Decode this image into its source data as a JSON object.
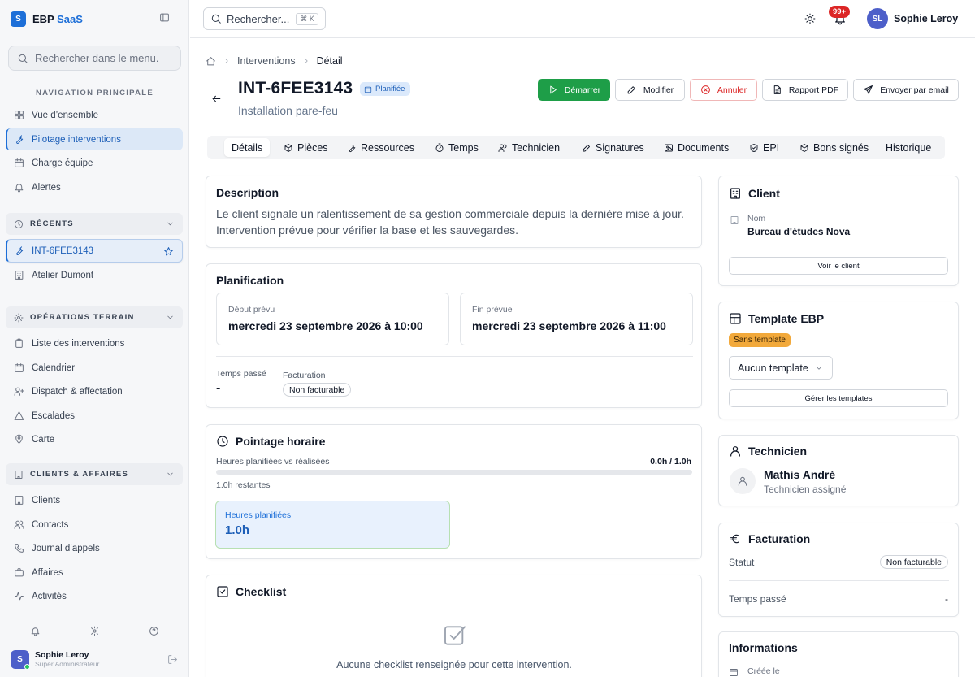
{
  "colors": {
    "accent": "#1d6fd8",
    "start": "#1e9e48",
    "danger": "#dc2626",
    "template_badge": "#f2a93b",
    "notif_badge": "#dc2626"
  },
  "sidebar": {
    "brand": {
      "logo_letter": "S",
      "name_prefix": "EBP",
      "name_accent": "SaaS"
    },
    "collapse_icon": "sidebar-toggle-icon",
    "search_placeholder": "Rechercher dans le menu.",
    "main_section_label": "NAVIGATION PRINCIPALE",
    "main_items": [
      {
        "label": "Vue d’ensemble",
        "icon": "grid-icon"
      },
      {
        "label": "Pilotage interventions",
        "icon": "wrench-icon",
        "active": true
      },
      {
        "label": "Charge équipe",
        "icon": "calendar-icon"
      },
      {
        "label": "Alertes",
        "icon": "bell-icon"
      }
    ],
    "recent_label": "RÉCENTS",
    "recent_items": [
      {
        "label": "INT-6FEE3143",
        "icon": "wrench-icon",
        "active": true
      },
      {
        "label": "Atelier Dumont",
        "icon": "building-icon"
      }
    ],
    "ops_label": "OPÉRATIONS TERRAIN",
    "ops_items": [
      {
        "label": "Liste des interventions",
        "icon": "clipboard-icon"
      },
      {
        "label": "Calendrier",
        "icon": "calendar-icon"
      },
      {
        "label": "Dispatch & affectation",
        "icon": "user-plus-icon"
      },
      {
        "label": "Escalades",
        "icon": "alert-triangle-icon"
      },
      {
        "label": "Carte",
        "icon": "map-pin-icon"
      }
    ],
    "clients_label": "CLIENTS & AFFAIRES",
    "clients_items": [
      {
        "label": "Clients",
        "icon": "building-icon"
      },
      {
        "label": "Contacts",
        "icon": "users-icon"
      },
      {
        "label": "Journal d’appels",
        "icon": "phone-icon"
      },
      {
        "label": "Affaires",
        "icon": "briefcase-icon"
      },
      {
        "label": "Activités",
        "icon": "activity-icon"
      }
    ],
    "user": {
      "initial": "S",
      "name": "Sophie Leroy",
      "role": "Super Administrateur"
    }
  },
  "topbar": {
    "search_placeholder": "Rechercher...",
    "shortcut": "⌘ K",
    "notif_count": "99+",
    "user_initials": "SL",
    "user_name": "Sophie Leroy"
  },
  "breadcrumb": [
    "Interventions",
    "Détail"
  ],
  "header": {
    "title": "INT-6FEE3143",
    "status": "Planifiée",
    "subtitle": "Installation pare-feu",
    "actions": {
      "start": "Démarrer",
      "edit": "Modifier",
      "cancel": "Annuler",
      "pdf": "Rapport PDF",
      "email": "Envoyer par email"
    }
  },
  "tabs": [
    "Détails",
    "Pièces",
    "Ressources",
    "Temps",
    "Technicien",
    "Signatures",
    "Documents",
    "EPI",
    "Bons signés",
    "Historique"
  ],
  "description": {
    "title": "Description",
    "text": "Le client signale un ralentissement de sa gestion commerciale depuis la dernière mise à jour. Intervention prévue pour vérifier la base et les sauvegardes."
  },
  "planning": {
    "title": "Planification",
    "start_label": "Début prévu",
    "start_value": "mercredi 23 septembre 2026 à 10:00",
    "end_label": "Fin prévue",
    "end_value": "mercredi 23 septembre 2026 à 11:00",
    "time_spent_label": "Temps passé",
    "time_spent_value": "-",
    "billing_label": "Facturation",
    "billing_value": "Non facturable"
  },
  "timesheet": {
    "title": "Pointage horaire",
    "progress_label": "Heures planifiées vs réalisées",
    "progress_value": "0.0h / 1.0h",
    "progress_fraction": 0,
    "remaining": "1.0h restantes",
    "planned_label": "Heures planifiées",
    "planned_value": "1.0h"
  },
  "checklist": {
    "title": "Checklist",
    "empty": "Aucune checklist renseignée pour cette intervention."
  },
  "client": {
    "title": "Client",
    "name_label": "Nom",
    "name_value": "Bureau d'études Nova",
    "button": "Voir le client"
  },
  "template": {
    "title": "Template EBP",
    "badge": "Sans template",
    "select_value": "Aucun template",
    "button": "Gérer les templates"
  },
  "technician": {
    "title": "Technicien",
    "name": "Mathis André",
    "role": "Technicien assigné"
  },
  "billing": {
    "title": "Facturation",
    "status_label": "Statut",
    "status_value": "Non facturable",
    "time_label": "Temps passé",
    "time_value": "-"
  },
  "info": {
    "title": "Informations",
    "created_label": "Créée le"
  }
}
